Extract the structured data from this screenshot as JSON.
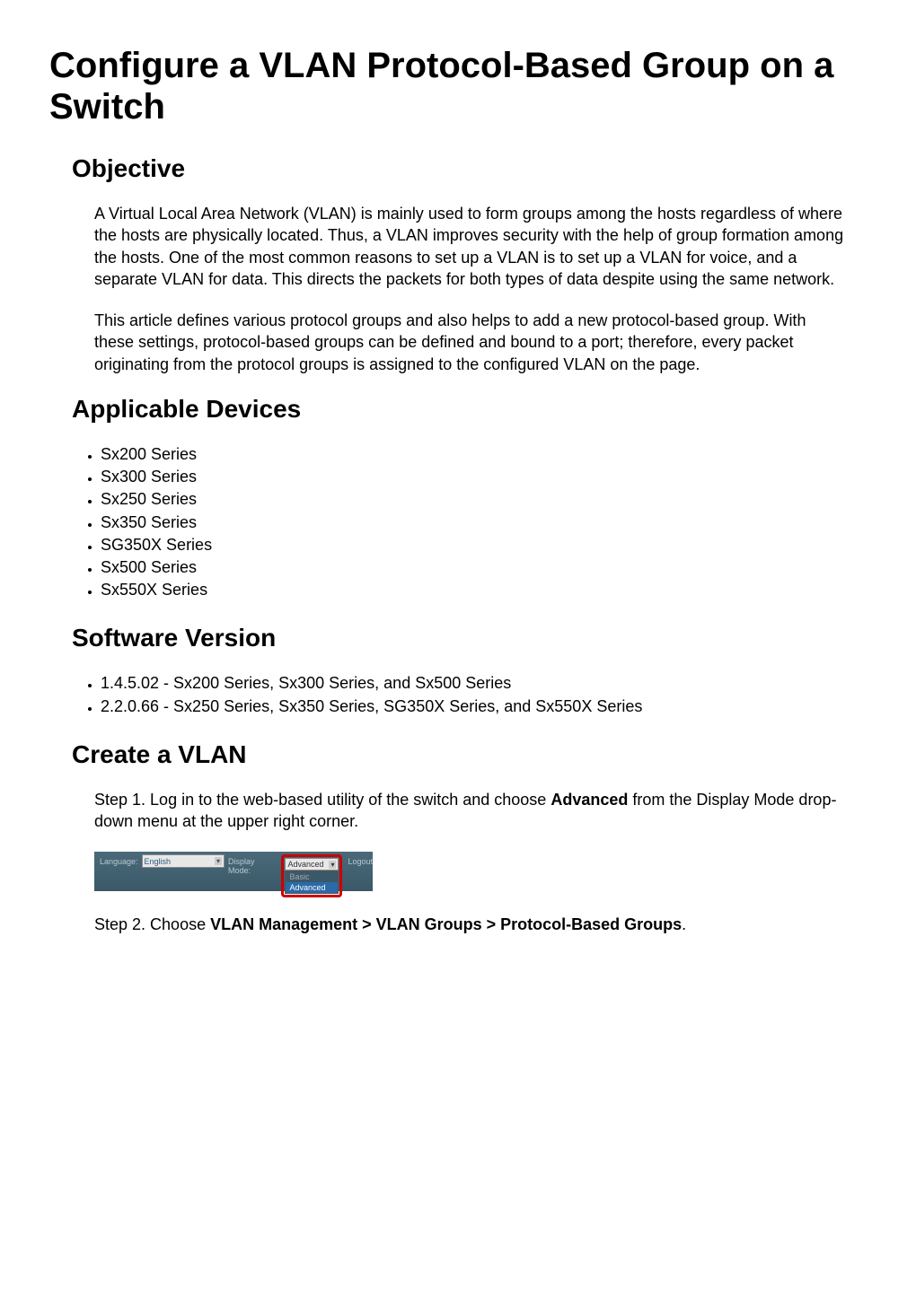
{
  "title": "Configure a VLAN Protocol-Based Group on a Switch",
  "sections": {
    "objective": {
      "heading": "Objective",
      "para1": "A Virtual Local Area Network (VLAN) is mainly used to form groups among the hosts regardless of where the hosts are physically located. Thus, a VLAN improves security with the help of group formation among the hosts. One of the most common reasons to set up a VLAN is to set up a VLAN for voice, and a separate VLAN for data. This directs the packets for both types of data despite using the same network.",
      "para2": "This article defines various protocol groups and also helps to add a new protocol-based group. With these settings, protocol-based groups can be defined and bound to a port; therefore, every packet originating from the protocol groups is assigned to the configured VLAN on the page."
    },
    "devices": {
      "heading": "Applicable Devices",
      "items": [
        "Sx200 Series",
        "Sx300 Series",
        "Sx250 Series",
        "Sx350 Series",
        "SG350X Series",
        "Sx500 Series",
        "Sx550X Series"
      ]
    },
    "software": {
      "heading": "Software Version",
      "items": [
        "1.4.5.02 - Sx200 Series, Sx300 Series, and Sx500 Series",
        "2.2.0.66 - Sx250 Series, Sx350 Series, SG350X Series, and Sx550X Series"
      ]
    },
    "create": {
      "heading": "Create a VLAN",
      "step1_prefix": "Step 1. Log in to the web-based utility of the switch and choose ",
      "step1_bold": "Advanced",
      "step1_suffix": " from the Display Mode drop-down menu at the upper right corner.",
      "step2_prefix": "Step 2. Choose ",
      "step2_bold": "VLAN Management > VLAN Groups > Protocol-Based Groups",
      "step2_suffix": "."
    }
  },
  "screenshot": {
    "language_label": "Language:",
    "language_value": "English",
    "display_label": "Display Mode:",
    "display_value": "Advanced",
    "option_basic": "Basic",
    "option_advanced": "Advanced",
    "logout": "Logout"
  }
}
